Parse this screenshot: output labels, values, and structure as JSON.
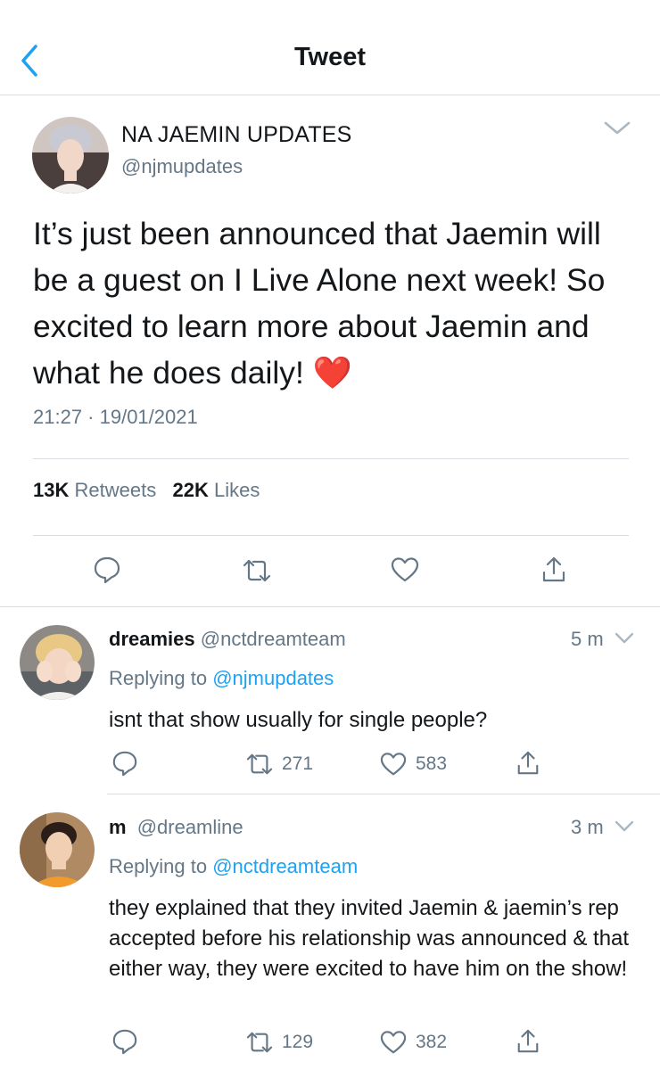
{
  "header": {
    "title": "Tweet"
  },
  "tweet": {
    "name": "NA JAEMIN UPDATES",
    "handle": "@njmupdates",
    "text": "It’s just been announced that Jaemin will be a guest on I Live Alone next week! So excited to learn more about Jaemin and what he does daily!",
    "emoji": "❤️",
    "timestamp": "21:27 · 19/01/2021",
    "retweets_count": "13K",
    "retweets_label": "Retweets",
    "likes_count": "22K",
    "likes_label": "Likes"
  },
  "replies": [
    {
      "name": "dreamies",
      "handle": "@nctdreamteam",
      "time": "5 m",
      "replying_prefix": "Replying to",
      "replying_to": "@njmupdates",
      "text": "isnt that show usually for single people?",
      "retweets": "271",
      "likes": "583"
    },
    {
      "name": "m",
      "handle": "@dreamline",
      "time": "3 m",
      "replying_prefix": "Replying to",
      "replying_to": "@nctdreamteam",
      "text": "they explained that they invited Jaemin & jaemin’s rep accepted before his relationship was announced & that either way, they were excited to have him on the show!",
      "retweets": "129",
      "likes": "382"
    }
  ],
  "icons": {
    "back": "chevron-left-icon",
    "more": "chevron-down-icon",
    "reply": "speech-bubble-icon",
    "retweet": "retweet-arrows-icon",
    "like": "heart-icon",
    "share": "share-upload-icon"
  },
  "colors": {
    "accent": "#1da1f2",
    "secondary_text": "#657786",
    "primary_text": "#14171a",
    "heart_emoji": "#e0212d"
  }
}
